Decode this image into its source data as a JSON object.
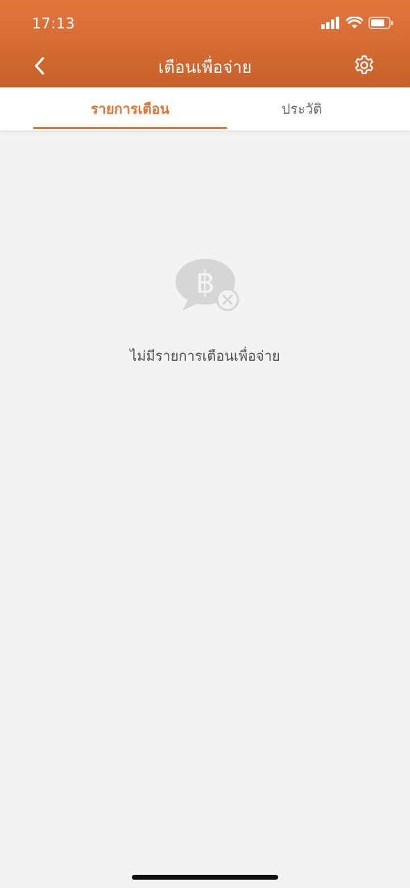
{
  "status_bar": {
    "time": "17:13",
    "icons": [
      "cellular-signal-icon",
      "wifi-icon",
      "battery-icon"
    ]
  },
  "nav": {
    "back_icon": "chevron-left-icon",
    "title": "เตือนเพื่อจ่าย",
    "settings_icon": "gear-icon"
  },
  "tabs": [
    {
      "label": "รายการเตือน",
      "active": true
    },
    {
      "label": "ประวัติ",
      "active": false
    }
  ],
  "empty_state": {
    "icon": "baht-chat-bubble-x-icon",
    "message": "ไม่มีรายการเตือนเพื่อจ่าย"
  },
  "colors": {
    "header_gradient_top": "#e2773d",
    "header_gradient_bottom": "#c7602a",
    "accent": "#e0763a",
    "background": "#f3f3f3",
    "tab_inactive_text": "#6b6b6b",
    "empty_icon": "#d6d6d6",
    "empty_text": "#555555"
  }
}
